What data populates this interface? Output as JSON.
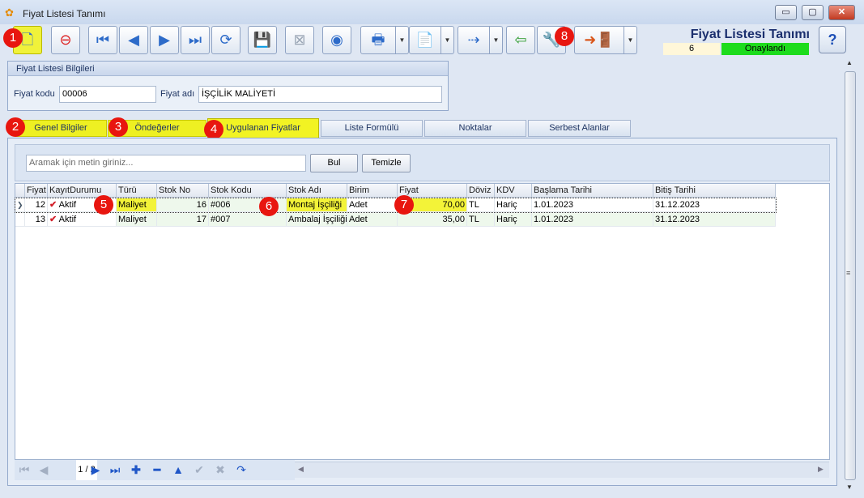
{
  "window": {
    "title": "Fiyat Listesi Tanımı",
    "minimize": "▭",
    "maximize": "▢",
    "close": "✕"
  },
  "header": {
    "form_title": "Fiyat Listesi Tanımı",
    "record_no": "6",
    "status": "Onaylandı"
  },
  "badges": [
    "1",
    "2",
    "3",
    "4",
    "5",
    "6",
    "7",
    "8"
  ],
  "info": {
    "group_title": "Fiyat Listesi Bilgileri",
    "code_label": "Fiyat kodu",
    "code_value": "00006",
    "name_label": "Fiyat adı",
    "name_value": "İŞÇİLİK MALİYETİ"
  },
  "tabs": [
    "Genel Bilgiler",
    "Öndeğerler",
    "Uygulanan Fiyatlar",
    "Liste Formülü",
    "Noktalar",
    "Serbest Alanlar"
  ],
  "search": {
    "placeholder": "Aramak için metin giriniz...",
    "find": "Bul",
    "clear": "Temizle"
  },
  "grid": {
    "columns": [
      "Fiyat",
      "KayıtDurumu",
      "Türü",
      "Stok No",
      "Stok Kodu",
      "Stok Adı",
      "Birim",
      "Fiyat",
      "Döviz",
      "KDV",
      "Başlama Tarihi",
      "Bitiş Tarihi"
    ],
    "rows": [
      {
        "fiyat": "12",
        "durum": "Aktif",
        "turu": "Maliyet",
        "stok_no": "16",
        "stok_kodu": "#006",
        "stok_adi": "Montaj İşçiliği",
        "birim": "Adet",
        "tutar": "70,00",
        "doviz": "TL",
        "kdv": "Hariç",
        "baslama": "1.01.2023",
        "bitis": "31.12.2023"
      },
      {
        "fiyat": "13",
        "durum": "Aktif",
        "turu": "Maliyet",
        "stok_no": "17",
        "stok_kodu": "#007",
        "stok_adi": "Ambalaj İşçiliği",
        "birim": "Adet",
        "tutar": "35,00",
        "doviz": "TL",
        "kdv": "Hariç",
        "baslama": "1.01.2023",
        "bitis": "31.12.2023"
      }
    ]
  },
  "navigator": {
    "page": "1 / 2"
  },
  "icons": [
    "new-document",
    "delete-document",
    "first-record",
    "previous-record",
    "next-record",
    "last-record",
    "refresh",
    "save",
    "save-cancel",
    "preview",
    "print",
    "pdf-export",
    "export",
    "import",
    "tools",
    "exit",
    "help"
  ]
}
